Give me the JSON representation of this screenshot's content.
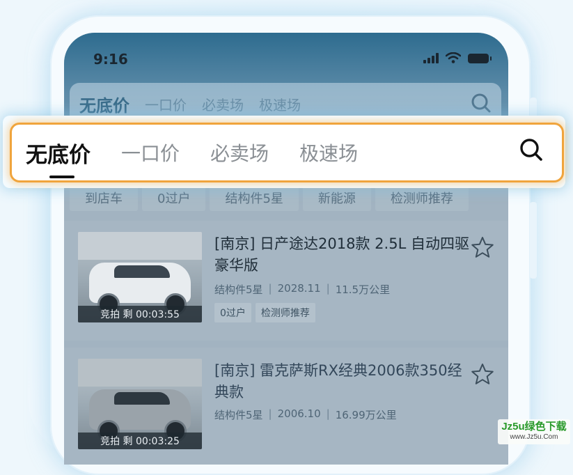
{
  "status_bar": {
    "time": "9:16"
  },
  "background_tabs": [
    "无底价",
    "一口价",
    "必卖场",
    "极速场"
  ],
  "filters": [
    "到店车",
    "0过户",
    "结构件5星",
    "新能源",
    "检测师推荐"
  ],
  "highlight_tabs": {
    "active": "无底价",
    "others": [
      "一口价",
      "必卖场",
      "极速场"
    ]
  },
  "listings": [
    {
      "title": "[南京] 日产途达2018款 2.5L 自动四驱豪华版",
      "structure": "结构件5星",
      "date": "2028.11",
      "mileage": "11.5万公里",
      "tags": [
        "0过户",
        "检测师推荐"
      ],
      "timer": "竞拍 剩 00:03:55"
    },
    {
      "title": "[南京] 雷克萨斯RX经典2006款350经典款",
      "structure": "结构件5星",
      "date": "2006.10",
      "mileage": "16.99万公里",
      "tags": [],
      "timer": "竞拍 剩 00:03:25"
    }
  ],
  "watermark": {
    "main": "Jz5u绿色下载",
    "url": "www.Jz5u.Com"
  },
  "icons": {
    "search": "search-icon",
    "favorite": "star-icon"
  },
  "colors": {
    "highlight_border": "#f0a43c",
    "active_tab_text": "#111111"
  }
}
